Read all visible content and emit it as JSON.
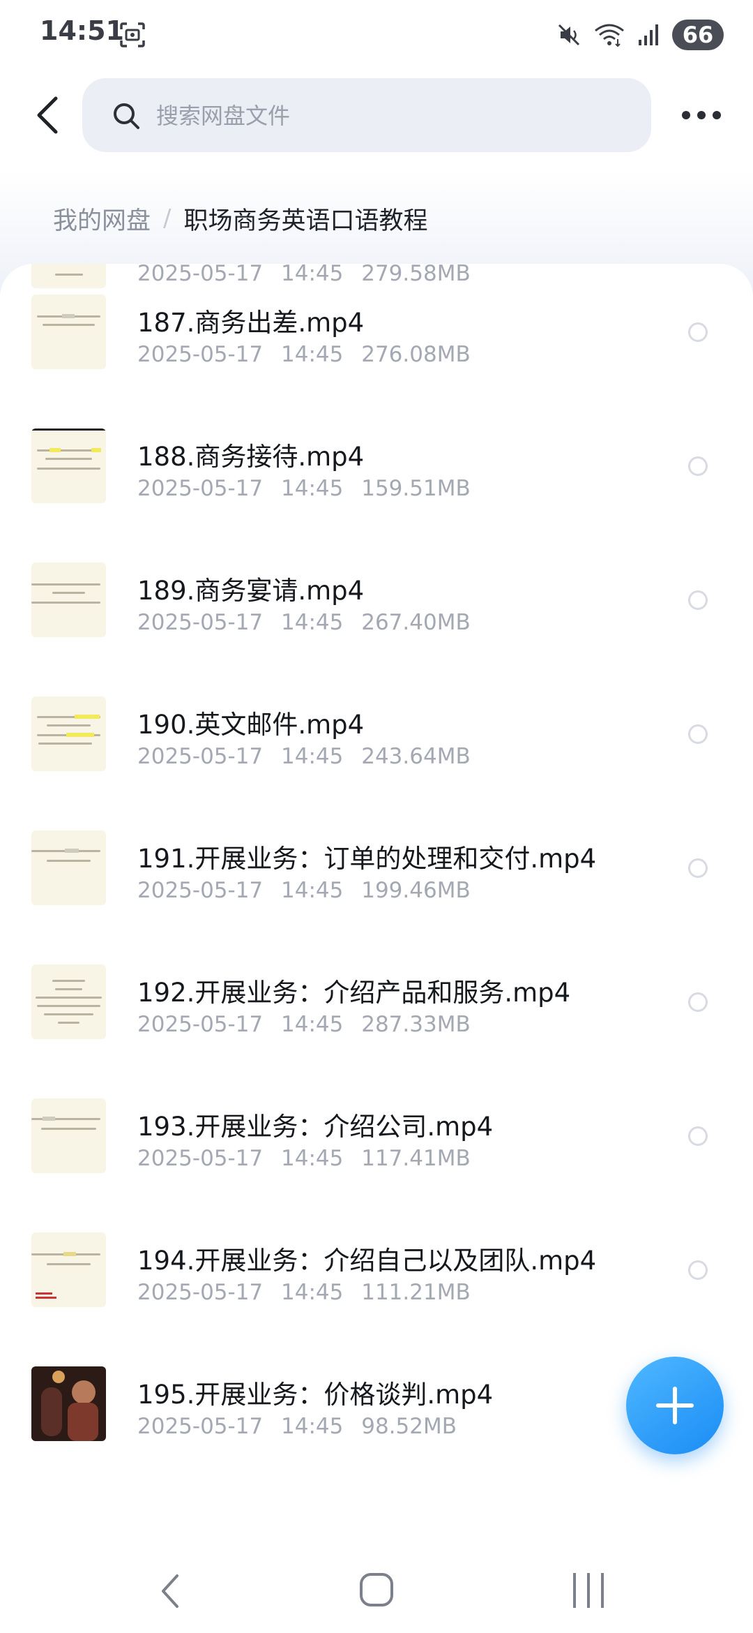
{
  "status_bar": {
    "time": "14:51",
    "battery": "66",
    "icons": [
      "screenshot-icon",
      "mute-icon",
      "wifi-icon",
      "signal-icon"
    ]
  },
  "search": {
    "placeholder": "搜索网盘文件"
  },
  "breadcrumb": {
    "root": "我的网盘",
    "separator": "/",
    "current": "职场商务英语口语教程"
  },
  "files": [
    {
      "name": "",
      "date": "2025-05-17",
      "time": "14:45",
      "size": "279.58MB"
    },
    {
      "name": "187.商务出差.mp4",
      "date": "2025-05-17",
      "time": "14:45",
      "size": "276.08MB"
    },
    {
      "name": "188.商务接待.mp4",
      "date": "2025-05-17",
      "time": "14:45",
      "size": "159.51MB"
    },
    {
      "name": "189.商务宴请.mp4",
      "date": "2025-05-17",
      "time": "14:45",
      "size": "267.40MB"
    },
    {
      "name": "190.英文邮件.mp4",
      "date": "2025-05-17",
      "time": "14:45",
      "size": "243.64MB"
    },
    {
      "name": "191.开展业务：订单的处理和交付.mp4",
      "date": "2025-05-17",
      "time": "14:45",
      "size": "199.46MB"
    },
    {
      "name": "192.开展业务：介绍产品和服务.mp4",
      "date": "2025-05-17",
      "time": "14:45",
      "size": "287.33MB"
    },
    {
      "name": "193.开展业务：介绍公司.mp4",
      "date": "2025-05-17",
      "time": "14:45",
      "size": "117.41MB"
    },
    {
      "name": "194.开展业务：介绍自己以及团队.mp4",
      "date": "2025-05-17",
      "time": "14:45",
      "size": "111.21MB"
    },
    {
      "name": "195.开展业务：价格谈判.mp4",
      "date": "2025-05-17",
      "time": "14:45",
      "size": "98.52MB"
    }
  ],
  "fab": {
    "icon": "plus-icon",
    "color": "#2196f3"
  },
  "nav": {
    "icons": [
      "nav-back-icon",
      "nav-home-icon",
      "nav-recents-icon"
    ]
  },
  "colors": {
    "accent": "#1a8cf5",
    "meta_text": "#a3a8b3",
    "title_text": "#15181d"
  }
}
